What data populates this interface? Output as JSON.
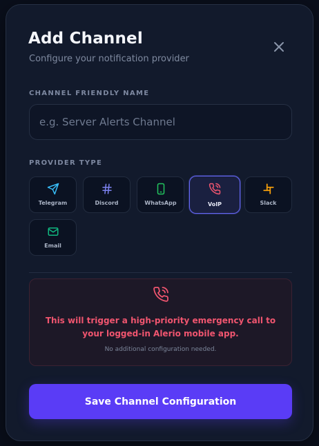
{
  "dialog": {
    "title": "Add Channel",
    "subtitle": "Configure your notification provider",
    "close_icon": "close-icon"
  },
  "name_field": {
    "label": "CHANNEL FRIENDLY NAME",
    "placeholder": "e.g. Server Alerts Channel",
    "value": ""
  },
  "provider_section": {
    "label": "PROVIDER TYPE",
    "selected": "VoIP",
    "providers": [
      {
        "label": "Telegram",
        "icon": "telegram-send-icon",
        "color": "#38bdf8"
      },
      {
        "label": "Discord",
        "icon": "hash-icon",
        "color": "#7c82f0"
      },
      {
        "label": "WhatsApp",
        "icon": "phone-device-icon",
        "color": "#22c55e"
      },
      {
        "label": "VoIP",
        "icon": "phone-call-icon",
        "color": "#f0556f"
      },
      {
        "label": "Slack",
        "icon": "slack-icon",
        "color": "#f59e0b"
      },
      {
        "label": "Email",
        "icon": "mail-icon",
        "color": "#10b981"
      }
    ]
  },
  "voip_notice": {
    "icon": "phone-call-icon",
    "message": "This will trigger a high-priority emergency call to your logged-in Alerio mobile app.",
    "note": "No additional configuration needed."
  },
  "actions": {
    "save_label": "Save Channel Configuration"
  },
  "colors": {
    "background": "#0a0f1c",
    "panel": "#121a2c",
    "accent": "#5a3cf6",
    "selected_border": "#6366f1",
    "alert_text": "#f0556f"
  }
}
